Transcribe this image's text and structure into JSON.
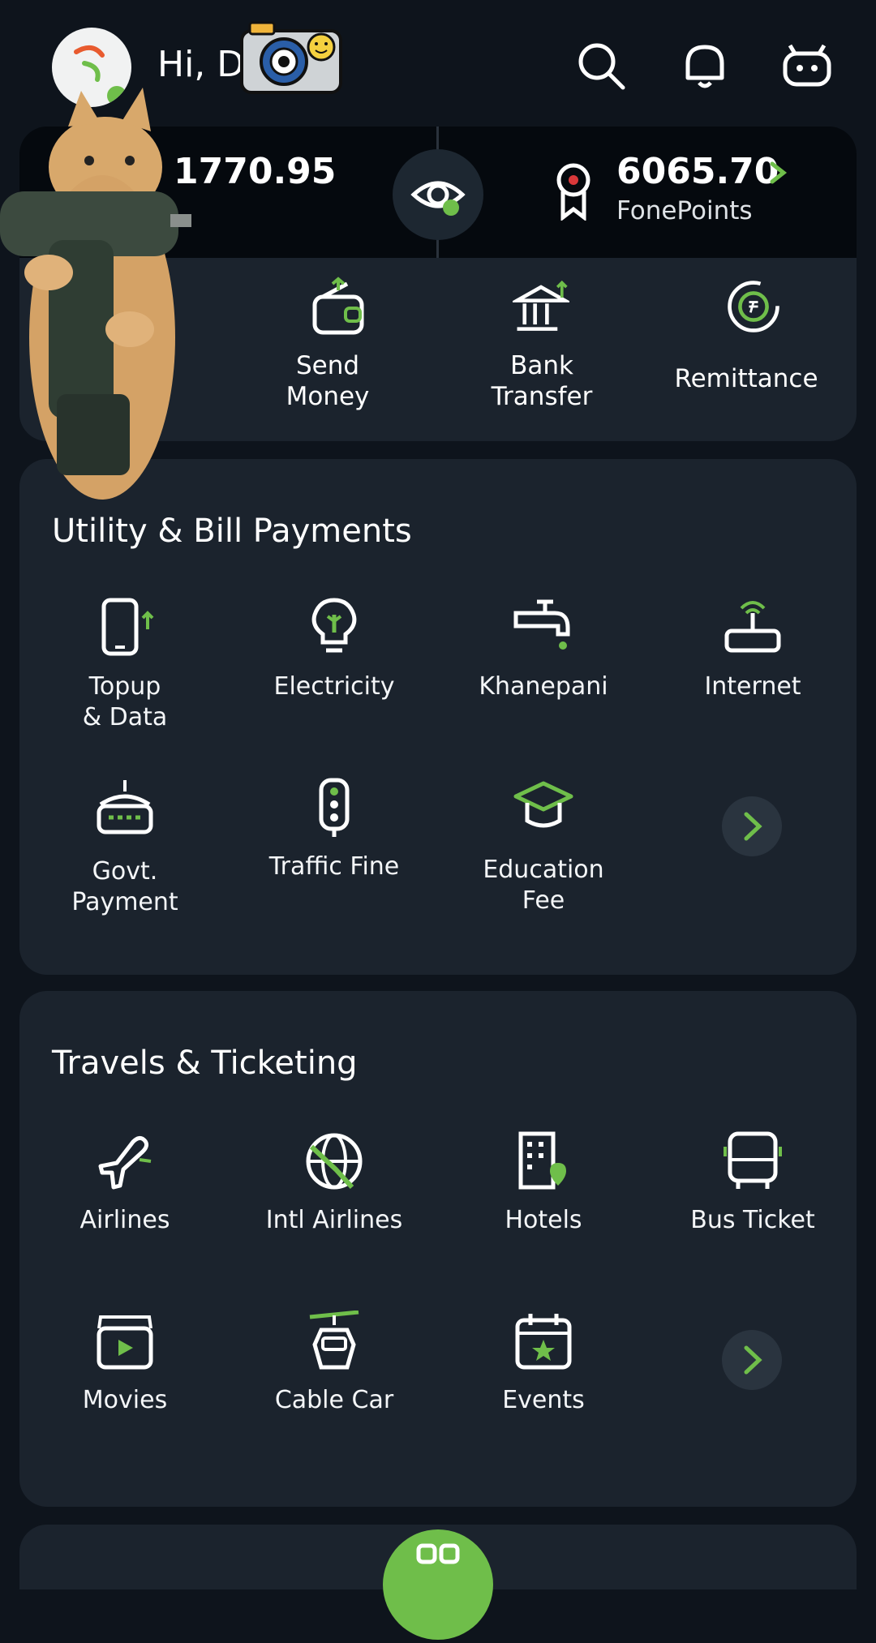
{
  "header": {
    "greeting": "Hi, D",
    "icons": [
      "search-icon",
      "bell-icon",
      "bot-icon"
    ]
  },
  "balance": {
    "amount": "1770.95",
    "points_value": "6065.70",
    "points_label": "FonePoints"
  },
  "quick_actions": [
    {
      "label": "Send\nMoney",
      "icon": "wallet-send-icon"
    },
    {
      "label": "Bank\nTransfer",
      "icon": "bank-icon"
    },
    {
      "label": "Remittance",
      "icon": "remittance-icon"
    }
  ],
  "utility": {
    "title": "Utility & Bill Payments",
    "items": [
      {
        "label": "Topup\n& Data",
        "icon": "phone-topup-icon"
      },
      {
        "label": "Electricity",
        "icon": "bulb-icon"
      },
      {
        "label": "Khanepani",
        "icon": "tap-icon"
      },
      {
        "label": "Internet",
        "icon": "router-icon"
      },
      {
        "label": "Govt.\nPayment",
        "icon": "government-icon"
      },
      {
        "label": "Traffic Fine",
        "icon": "traffic-light-icon"
      },
      {
        "label": "Education\nFee",
        "icon": "graduation-cap-icon"
      }
    ]
  },
  "travel": {
    "title": "Travels & Ticketing",
    "items": [
      {
        "label": "Airlines",
        "icon": "airplane-icon"
      },
      {
        "label": "Intl Airlines",
        "icon": "globe-plane-icon"
      },
      {
        "label": "Hotels",
        "icon": "hotel-icon"
      },
      {
        "label": "Bus Ticket",
        "icon": "bus-icon"
      },
      {
        "label": "Movies",
        "icon": "clapper-icon"
      },
      {
        "label": "Cable Car",
        "icon": "cable-car-icon"
      },
      {
        "label": "Events",
        "icon": "calendar-icon"
      }
    ]
  },
  "colors": {
    "accent": "#6fbe4a",
    "panel": "#1b232d",
    "background": "#0e141c"
  }
}
